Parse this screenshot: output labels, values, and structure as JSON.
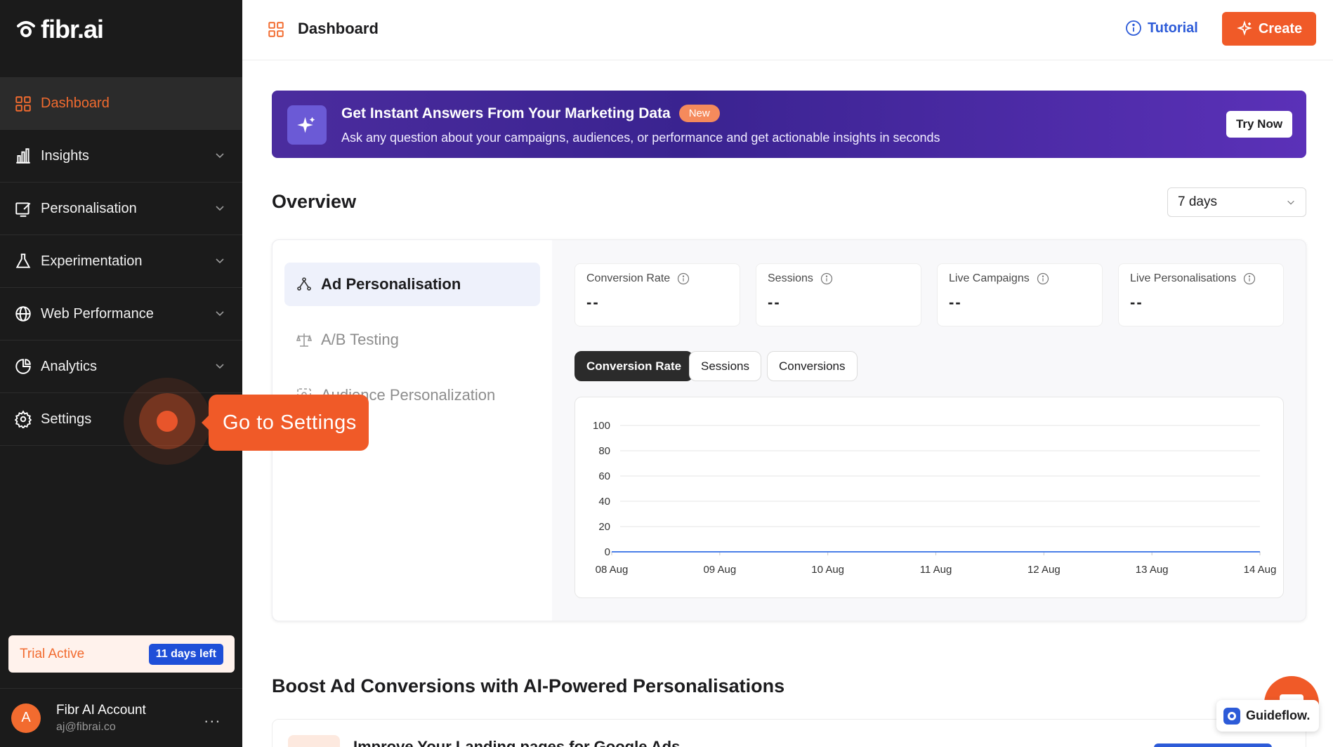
{
  "brand": {
    "logo_text": "fibr.ai"
  },
  "sidebar": {
    "items": [
      {
        "label": "Dashboard",
        "icon": "grid-icon",
        "active": true,
        "expandable": false
      },
      {
        "label": "Insights",
        "icon": "bar-chart-icon",
        "active": false,
        "expandable": true
      },
      {
        "label": "Personalisation",
        "icon": "edit-screen-icon",
        "active": false,
        "expandable": true
      },
      {
        "label": "Experimentation",
        "icon": "flask-icon",
        "active": false,
        "expandable": true
      },
      {
        "label": "Web Performance",
        "icon": "globe-icon",
        "active": false,
        "expandable": true
      },
      {
        "label": "Analytics",
        "icon": "pie-chart-icon",
        "active": false,
        "expandable": true
      },
      {
        "label": "Settings",
        "icon": "gear-icon",
        "active": false,
        "expandable": false
      }
    ],
    "trial": {
      "label": "Trial Active",
      "badge": "11 days left"
    },
    "account": {
      "initial": "A",
      "name": "Fibr AI Account",
      "email": "aj@fibrai.co",
      "more": "..."
    }
  },
  "header": {
    "title": "Dashboard",
    "tutorial_label": "Tutorial",
    "create_label": "Create"
  },
  "banner": {
    "title": "Get Instant Answers From Your Marketing Data",
    "badge": "New",
    "subtitle": "Ask any question about your campaigns, audiences, or performance and get actionable insights in seconds",
    "cta": "Try Now"
  },
  "overview": {
    "title": "Overview",
    "range": "7 days",
    "types": [
      {
        "label": "Ad Personalisation",
        "active": true
      },
      {
        "label": "A/B Testing",
        "active": false
      },
      {
        "label": "Audience Personalization",
        "active": false
      }
    ],
    "stats": [
      {
        "label": "Conversion Rate",
        "value": "--"
      },
      {
        "label": "Sessions",
        "value": "--"
      },
      {
        "label": "Live Campaigns",
        "value": "--"
      },
      {
        "label": "Live Personalisations",
        "value": "--"
      }
    ],
    "metric_tabs": [
      {
        "label": "Conversion Rate",
        "active": true
      },
      {
        "label": "Sessions",
        "active": false
      },
      {
        "label": "Conversions",
        "active": false
      }
    ]
  },
  "chart_data": {
    "type": "line",
    "categories": [
      "08 Aug",
      "09 Aug",
      "10 Aug",
      "11 Aug",
      "12 Aug",
      "13 Aug",
      "14 Aug"
    ],
    "series": [
      {
        "values": [
          0,
          0,
          0,
          0,
          0,
          0,
          0
        ],
        "color": "#4a7fe8"
      }
    ],
    "ylim": [
      0,
      100
    ],
    "yticks": [
      0,
      20,
      40,
      60,
      80,
      100
    ],
    "grid": true,
    "title": "",
    "xlabel": "",
    "ylabel": ""
  },
  "boost": {
    "title": "Boost Ad Conversions with AI-Powered Personalisations",
    "card_text": "Improve Your Landing pages for Google Ads"
  },
  "tooltip": {
    "text": "Go to Settings"
  },
  "widgets": {
    "guideflow_label": "Guideflow."
  },
  "colors": {
    "accent": "#f05a28",
    "sidebar_bg": "#1b1b1b",
    "link_blue": "#2d5bd8",
    "banner_purple": "#3a2390"
  }
}
